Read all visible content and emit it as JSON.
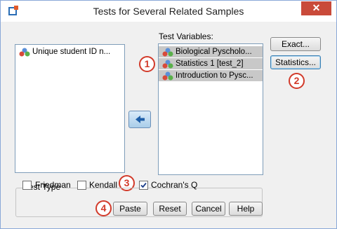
{
  "window": {
    "title": "Tests for Several Related Samples",
    "close_glyph": "✕"
  },
  "source_list": {
    "items": [
      {
        "label": "Unique student ID n..."
      }
    ]
  },
  "target_list": {
    "label": "Test Variables:",
    "items": [
      {
        "label": "Biological Pyscholo..."
      },
      {
        "label": "Statistics 1 [test_2]"
      },
      {
        "label": "Introduction to Pysc..."
      }
    ]
  },
  "buttons": {
    "exact": "Exact...",
    "statistics": "Statistics...",
    "paste": "Paste",
    "reset": "Reset",
    "cancel": "Cancel",
    "help": "Help"
  },
  "test_type": {
    "label": "Test Type",
    "friedman": {
      "label": "Friedman",
      "checked": false
    },
    "kendall": {
      "label": "Kendall's W",
      "checked": false
    },
    "cochran": {
      "label": "Cochran's Q",
      "checked": true
    }
  },
  "markers": [
    "1",
    "2",
    "3",
    "4"
  ],
  "colors": {
    "marker_red": "#d23a2a",
    "selection_gray": "#c8c8c8",
    "close_red": "#c94a3a"
  }
}
